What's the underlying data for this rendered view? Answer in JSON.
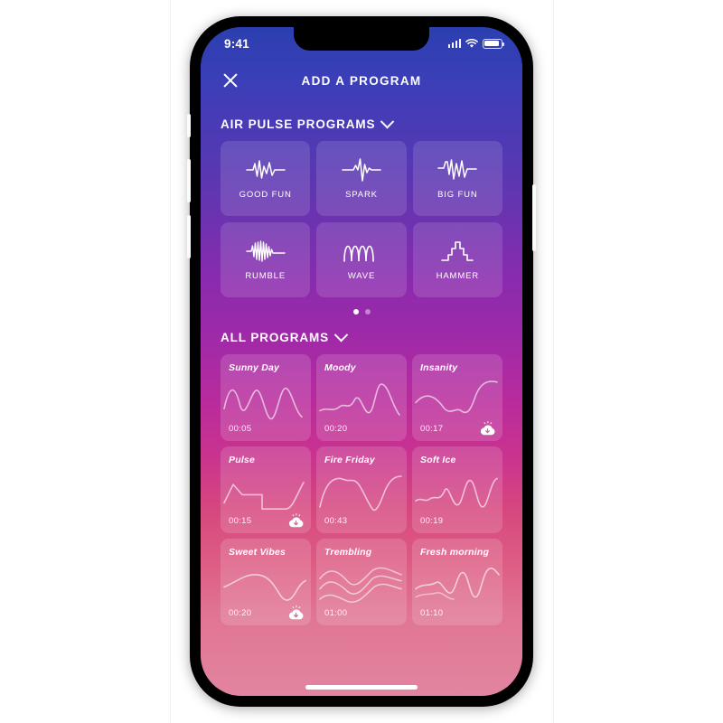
{
  "status_bar": {
    "time": "9:41",
    "signal_icon": "cellular-signal-icon",
    "wifi_icon": "wifi-icon",
    "battery_icon": "battery-icon"
  },
  "nav": {
    "close_icon": "close-icon",
    "title": "ADD A PROGRAM"
  },
  "sections": {
    "air_pulse": {
      "label": "AIR PULSE PROGRAMS",
      "chevron_icon": "chevron-down-icon",
      "tiles": [
        {
          "name": "GOOD FUN",
          "icon": "waveform-good-fun-icon"
        },
        {
          "name": "SPARK",
          "icon": "waveform-spark-icon"
        },
        {
          "name": "BIG FUN",
          "icon": "waveform-big-fun-icon"
        },
        {
          "name": "RUMBLE",
          "icon": "waveform-rumble-icon"
        },
        {
          "name": "WAVE",
          "icon": "waveform-wave-icon"
        },
        {
          "name": "HAMMER",
          "icon": "waveform-hammer-icon"
        }
      ],
      "pagination": {
        "total": 2,
        "active": 1
      }
    },
    "all_programs": {
      "label": "ALL PROGRAMS",
      "chevron_icon": "chevron-down-icon",
      "cards": [
        {
          "name": "Sunny Day",
          "duration": "00:05",
          "downloadable": false
        },
        {
          "name": "Moody",
          "duration": "00:20",
          "downloadable": false
        },
        {
          "name": "Insanity",
          "duration": "00:17",
          "downloadable": true
        },
        {
          "name": "Pulse",
          "duration": "00:15",
          "downloadable": true
        },
        {
          "name": "Fire Friday",
          "duration": "00:43",
          "downloadable": false
        },
        {
          "name": "Soft Ice",
          "duration": "00:19",
          "downloadable": false
        },
        {
          "name": "Sweet Vibes",
          "duration": "00:20",
          "downloadable": true
        },
        {
          "name": "Trembling",
          "duration": "01:00",
          "downloadable": false
        },
        {
          "name": "Fresh morning",
          "duration": "01:10",
          "downloadable": false
        }
      ],
      "download_icon": "cloud-download-icon"
    }
  },
  "colors": {
    "gradient_top": "#2b3fb0",
    "gradient_mid": "#a32aa6",
    "gradient_bottom": "#e385a0",
    "tile_surface": "rgba(255,255,255,0.13)",
    "text": "#ffffff"
  },
  "home_indicator": "home-indicator"
}
